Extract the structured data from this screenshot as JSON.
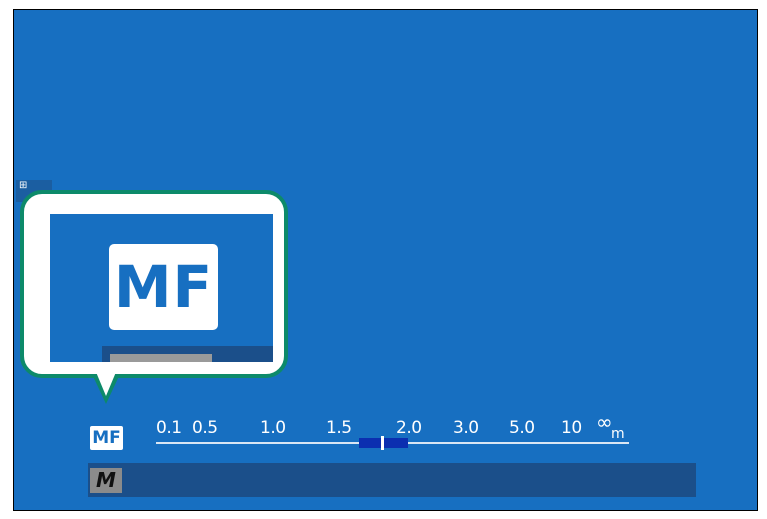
{
  "viewfinder": {
    "background_color": "#176fc1",
    "corner_icon": "focus-frame-icon",
    "corner_icon_text": "⊞"
  },
  "callout": {
    "border_color": "#0d8a6a",
    "mf_label": "MF",
    "bar_fill_color": "#9a9a9a"
  },
  "distance_indicator": {
    "mf_label": "MF",
    "scale_labels": [
      "0.1",
      "0.5",
      "1.0",
      "1.5",
      "2.0",
      "3.0",
      "5.0",
      "10",
      "∞"
    ],
    "unit": "m",
    "dof_color": "#0b2fb0"
  },
  "mode": {
    "label": "M"
  }
}
